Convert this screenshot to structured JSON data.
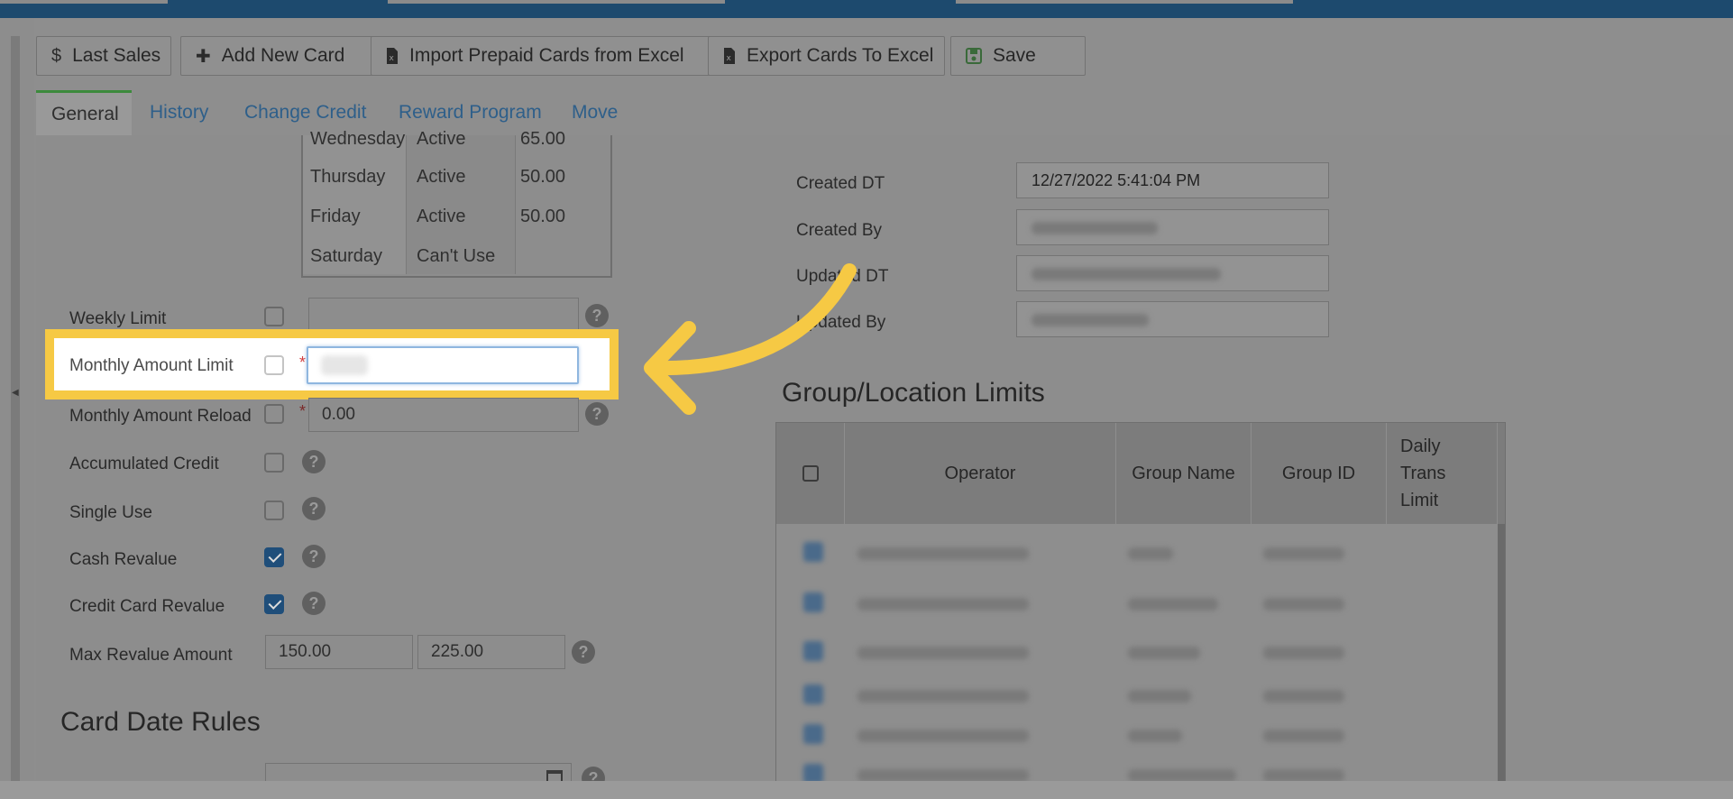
{
  "toolbar": {
    "last_sales": {
      "icon": "dollar-icon",
      "glyph": "$",
      "label": "Last Sales"
    },
    "add_new_card": {
      "icon": "plus-icon",
      "glyph": "✚",
      "label": "Add New Card"
    },
    "import_prepaid": {
      "icon": "excel-file-icon",
      "label": "Import Prepaid Cards from Excel"
    },
    "export_cards": {
      "icon": "excel-file-icon",
      "label": "Export Cards To Excel"
    },
    "save": {
      "icon": "floppy-icon",
      "label": "Save"
    }
  },
  "tabs": [
    {
      "label": "General",
      "active": true
    },
    {
      "label": "History"
    },
    {
      "label": "Change Credit"
    },
    {
      "label": "Reward Program"
    },
    {
      "label": "Move"
    }
  ],
  "days_table": {
    "rows": [
      {
        "day": "Wednesday",
        "status": "Active",
        "amount": "65.00"
      },
      {
        "day": "Thursday",
        "status": "Active",
        "amount": "50.00"
      },
      {
        "day": "Friday",
        "status": "Active",
        "amount": "50.00"
      },
      {
        "day": "Saturday",
        "status": "Can't Use",
        "amount": ""
      }
    ]
  },
  "fields": {
    "weekly_limit": {
      "label": "Weekly Limit",
      "checked": false,
      "value": ""
    },
    "monthly_amount_limit": {
      "label": "Monthly Amount Limit",
      "checked": false,
      "value": ""
    },
    "monthly_amount_reload": {
      "label": "Monthly Amount Reload",
      "checked": false,
      "value": "0.00"
    },
    "accumulated_credit": {
      "label": "Accumulated Credit",
      "checked": false
    },
    "single_use": {
      "label": "Single Use",
      "checked": false
    },
    "cash_revalue": {
      "label": "Cash Revalue",
      "checked": true
    },
    "credit_card_revalue": {
      "label": "Credit Card Revalue",
      "checked": true
    },
    "max_revalue_amount": {
      "label": "Max Revalue Amount",
      "value1": "150.00",
      "value2": "225.00"
    }
  },
  "sections": {
    "card_date_rules": "Card Date Rules",
    "group_location_limits": "Group/Location Limits"
  },
  "audit": {
    "created_dt": {
      "label": "Created DT",
      "value": "12/27/2022 5:41:04 PM"
    },
    "created_by": {
      "label": "Created By"
    },
    "updated_dt": {
      "label": "Updated DT"
    },
    "updated_by": {
      "label": "Updated By"
    }
  },
  "group_table": {
    "headers": {
      "operator": "Operator",
      "group_name": "Group Name",
      "group_id": "Group ID",
      "daily_trans_limit": "Daily Trans Limit"
    }
  },
  "colors": {
    "highlight": "#f6c944",
    "checkbox_checked": "#1f4e7a",
    "topbar": "#1d4a6e"
  }
}
